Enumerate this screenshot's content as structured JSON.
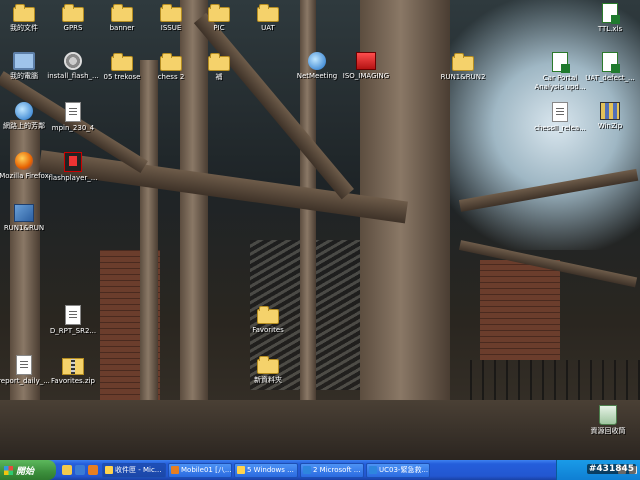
{
  "desktop": {
    "icons": [
      {
        "label": "我的文件"
      },
      {
        "label": "GPRS"
      },
      {
        "label": "banner"
      },
      {
        "label": "ISSUE"
      },
      {
        "label": "PIC"
      },
      {
        "label": "UAT"
      },
      {
        "label": "TTL.xls"
      },
      {
        "label": "我的電腦"
      },
      {
        "label": "install_flash_..."
      },
      {
        "label": "05 trekose"
      },
      {
        "label": "chess 2"
      },
      {
        "label": "補"
      },
      {
        "label": "NetMeeting"
      },
      {
        "label": "ISO_IMAGING"
      },
      {
        "label": "RUN1&RUN2"
      },
      {
        "label": "Car Portal Analysis upd..."
      },
      {
        "label": "UAT_defect_..."
      },
      {
        "label": "網路上的芳鄰"
      },
      {
        "label": "mpin_230_4"
      },
      {
        "label": "chessII_relea..."
      },
      {
        "label": "WinZip"
      },
      {
        "label": "Mozilla Firefox"
      },
      {
        "label": "flashplayer_..."
      },
      {
        "label": "RUN1&RUN"
      },
      {
        "label": "D_RPT_SR2..."
      },
      {
        "label": "Favorites"
      },
      {
        "label": "report_daily_..."
      },
      {
        "label": "Favorites.zip"
      },
      {
        "label": "新資料夾"
      },
      {
        "label": "資源回收筒"
      }
    ]
  },
  "taskbar": {
    "start_label": "開始",
    "tasks": [
      {
        "label": "收件匣 - Mic..."
      },
      {
        "label": "Mobile01 [八..."
      },
      {
        "label": "5 Windows ..."
      },
      {
        "label": "2 Microsoft ..."
      },
      {
        "label": "UC03-緊急救..."
      }
    ]
  },
  "watermark": "#431845"
}
